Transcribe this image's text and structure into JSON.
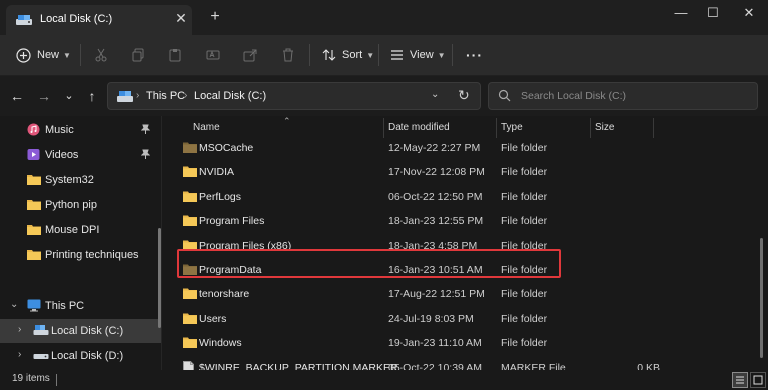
{
  "tab": {
    "title": "Local Disk (C:)",
    "close": "✕",
    "new_tab": "+"
  },
  "window_controls": {
    "minimize": "—",
    "maximize": "☐",
    "close": "✕"
  },
  "toolbar": {
    "new_label": "New",
    "sort_label": "Sort",
    "view_label": "View",
    "more": "···"
  },
  "address": {
    "crumbs": [
      "This PC",
      "Local Disk (C:)"
    ],
    "separator": "›",
    "dropdown": "⌄",
    "refresh": "↻"
  },
  "search": {
    "placeholder": "Search Local Disk (C:)"
  },
  "nav": {
    "back": "←",
    "forward": "→",
    "recent": "⌄",
    "up": "↑"
  },
  "sidebar": {
    "items": [
      {
        "label": "Music",
        "icon": "music-icon",
        "pinned": true
      },
      {
        "label": "Videos",
        "icon": "videos-icon",
        "pinned": true
      },
      {
        "label": "System32",
        "icon": "folder-icon",
        "pinned": false
      },
      {
        "label": "Python pip",
        "icon": "folder-icon",
        "pinned": false
      },
      {
        "label": "Mouse DPI",
        "icon": "folder-icon",
        "pinned": false
      },
      {
        "label": "Printing techniques",
        "icon": "folder-icon",
        "pinned": false
      },
      {
        "label": "This PC",
        "icon": "monitor-icon",
        "expanded": true
      },
      {
        "label": "Local Disk (C:)",
        "icon": "drive-icon",
        "selected": true
      },
      {
        "label": "Local Disk (D:)",
        "icon": "drive-icon",
        "selected": false
      }
    ],
    "pin_glyph": "📌"
  },
  "columns": {
    "name": "Name",
    "date": "Date modified",
    "type": "Type",
    "size": "Size"
  },
  "files": [
    {
      "name": "MSOCache",
      "date": "12-May-22 2:27 PM",
      "type": "File folder",
      "size": "",
      "kind": "folder-dim"
    },
    {
      "name": "NVIDIA",
      "date": "17-Nov-22 12:08 PM",
      "type": "File folder",
      "size": "",
      "kind": "folder"
    },
    {
      "name": "PerfLogs",
      "date": "06-Oct-22 12:50 PM",
      "type": "File folder",
      "size": "",
      "kind": "folder"
    },
    {
      "name": "Program Files",
      "date": "18-Jan-23 12:55 PM",
      "type": "File folder",
      "size": "",
      "kind": "folder"
    },
    {
      "name": "Program Files (x86)",
      "date": "18-Jan-23 4:58 PM",
      "type": "File folder",
      "size": "",
      "kind": "folder"
    },
    {
      "name": "ProgramData",
      "date": "16-Jan-23 10:51 AM",
      "type": "File folder",
      "size": "",
      "kind": "folder-dim"
    },
    {
      "name": "tenorshare",
      "date": "17-Aug-22 12:51 PM",
      "type": "File folder",
      "size": "",
      "kind": "folder"
    },
    {
      "name": "Users",
      "date": "24-Jul-19 8:03 PM",
      "type": "File folder",
      "size": "",
      "kind": "folder"
    },
    {
      "name": "Windows",
      "date": "19-Jan-23 11:10 AM",
      "type": "File folder",
      "size": "",
      "kind": "folder"
    },
    {
      "name": "$WINRE_BACKUP_PARTITION.MARKER",
      "date": "05-Oct-22 10:39 AM",
      "type": "MARKER File",
      "size": "0 KB",
      "kind": "file"
    }
  ],
  "status": {
    "count": "19 items"
  },
  "colors": {
    "accent_red": "#e0383b",
    "folder": "#e8b64a",
    "folder_dim": "#8e7443"
  }
}
